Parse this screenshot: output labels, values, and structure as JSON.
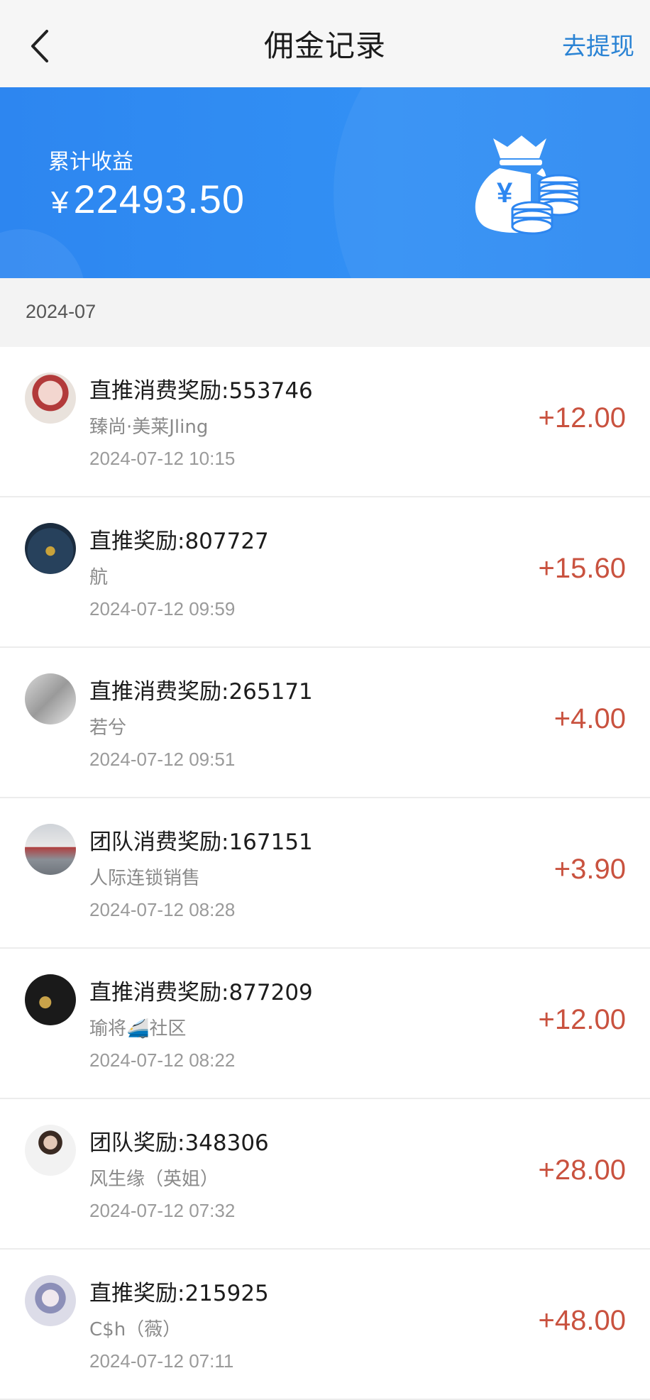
{
  "header": {
    "title": "佣金记录",
    "action_label": "去提现"
  },
  "summary": {
    "label": "累计收益",
    "currency": "¥",
    "amount": "22493.50"
  },
  "month": "2024-07",
  "colors": {
    "accent": "#2d86f0",
    "amount": "#c9523f",
    "link": "#2a83d4"
  },
  "records": [
    {
      "title": "直推消费奖励:553746",
      "name": "臻尚·美莱Jling",
      "time": "2024-07-12 10:15",
      "amount": "+12.00"
    },
    {
      "title": "直推奖励:807727",
      "name": "航",
      "time": "2024-07-12 09:59",
      "amount": "+15.60"
    },
    {
      "title": "直推消费奖励:265171",
      "name": "若兮",
      "time": "2024-07-12 09:51",
      "amount": "+4.00"
    },
    {
      "title": "团队消费奖励:167151",
      "name": "人际连锁销售",
      "time": "2024-07-12 08:28",
      "amount": "+3.90"
    },
    {
      "title": "直推消费奖励:877209",
      "name": "瑜将🚄社区",
      "time": "2024-07-12 08:22",
      "amount": "+12.00"
    },
    {
      "title": "团队奖励:348306",
      "name": "风生缘（英姐）",
      "time": "2024-07-12 07:32",
      "amount": "+28.00"
    },
    {
      "title": "直推奖励:215925",
      "name": "C$h（薇）",
      "time": "2024-07-12 07:11",
      "amount": "+48.00"
    }
  ]
}
